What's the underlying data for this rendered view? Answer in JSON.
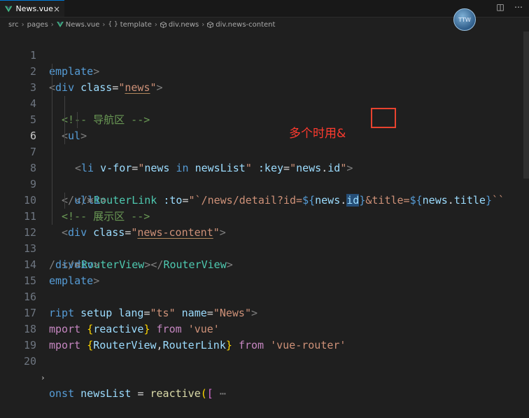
{
  "tab": {
    "title": "News.vue",
    "close": "×"
  },
  "actions": {
    "split": "◫",
    "more": "⋯"
  },
  "breadcrumb": [
    "src",
    "pages",
    "News.vue",
    "template",
    "div.news",
    "div.news-content"
  ],
  "avatar": {
    "text": "TTW"
  },
  "annotation": "多个时用&",
  "colors": {
    "accent": "#0078d4",
    "highlight_box": "#e8432f",
    "annotation": "#ff3b2f"
  },
  "lines": [
    {
      "n": "1",
      "parts": [
        [
          "t-punc",
          "template"
        ],
        [
          "t-punc",
          ">"
        ]
      ],
      "raw": "emplate>"
    },
    {
      "n": "2",
      "raw": "<div class=\"news\">"
    },
    {
      "n": "3",
      "raw": "<!-- 导航区 -->"
    },
    {
      "n": "4",
      "raw": "<ul>"
    },
    {
      "n": "5",
      "raw": "<li v-for=\"news in newsList\" :key=\"news.id\">"
    },
    {
      "n": "6",
      "raw": "<RouterLink :to=\"`/news/detail?id=${news.id}&title=${news.title}`"
    },
    {
      "n": "7",
      "raw": "</li>"
    },
    {
      "n": "8",
      "raw": "</ul>"
    },
    {
      "n": "9",
      "raw": "<!-- 展示区 -->"
    },
    {
      "n": "10",
      "raw": "<div class=\"news-content\">"
    },
    {
      "n": "11",
      "raw": "<RouterView></RouterView>"
    },
    {
      "n": "12",
      "raw": "</div>"
    },
    {
      "n": "13",
      "raw": "</div>"
    },
    {
      "n": "14",
      "raw": "emplate>"
    },
    {
      "n": "15",
      "raw": ""
    },
    {
      "n": "16",
      "raw": "ript setup lang=\"ts\" name=\"News\">"
    },
    {
      "n": "17",
      "raw": "mport {reactive} from 'vue'"
    },
    {
      "n": "18",
      "raw": "mport {RouterView,RouterLink} from 'vue-router'"
    },
    {
      "n": "19",
      "raw": ""
    },
    {
      "n": "20",
      "raw": "onst newsList = reactive([…"
    }
  ],
  "tokens": {
    "l1": [
      "emplate",
      ">"
    ],
    "l2": [
      "<",
      "div",
      " ",
      "class",
      "=",
      "\"",
      "news",
      "\"",
      ">"
    ],
    "l3": [
      "<!-- 导航区 -->"
    ],
    "l4": [
      "<",
      "ul",
      ">"
    ],
    "l5": [
      "<",
      "li",
      " ",
      "v-for",
      "=",
      "\"",
      "news",
      " ",
      "in",
      " ",
      "newsList",
      "\"",
      " ",
      ":key",
      "=",
      "\"",
      "news",
      ".",
      "id",
      "\"",
      ">"
    ],
    "l6": [
      "<",
      "RouterLink",
      " ",
      ":to",
      "=",
      "\"",
      "`/news/detail?id=",
      "${",
      "news",
      ".",
      "id",
      "}",
      "&title=",
      "${",
      "news",
      ".",
      "title",
      "}",
      "`",
      "`"
    ],
    "l7": [
      "</",
      "li",
      ">"
    ],
    "l8": [
      "</",
      "ul",
      ">"
    ],
    "l9": [
      "<!-- 展示区 -->"
    ],
    "l10": [
      "<",
      "div",
      " ",
      "class",
      "=",
      "\"",
      "news-content",
      "\"",
      ">"
    ],
    "l11": [
      "<",
      "RouterView",
      "></",
      "RouterView",
      ">"
    ],
    "l12": [
      "</",
      "div",
      ">"
    ],
    "l13": [
      "/",
      "div",
      ">"
    ],
    "l14": [
      "emplate",
      ">"
    ],
    "l16": [
      "ript",
      " ",
      "setup",
      " ",
      "lang",
      "=",
      "\"ts\"",
      " ",
      "name",
      "=",
      "\"News\"",
      ">"
    ],
    "l17": [
      "mport",
      " ",
      "{",
      "reactive",
      "}",
      " ",
      "from",
      " ",
      "'vue'"
    ],
    "l18": [
      "mport",
      " ",
      "{",
      "RouterView",
      ",",
      "RouterLink",
      "}",
      " ",
      "from",
      " ",
      "'vue-router'"
    ],
    "l20": [
      "onst",
      " ",
      "newsList",
      " ",
      "=",
      " ",
      "reactive",
      "(",
      "[",
      " ",
      "⋯"
    ]
  }
}
